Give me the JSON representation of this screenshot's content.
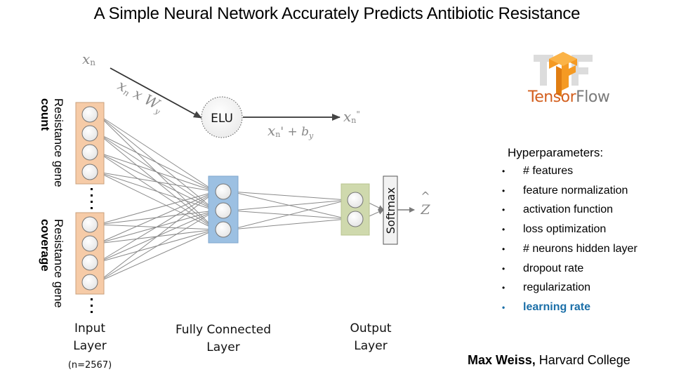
{
  "title": "A Simple Neural Network Accurately Predicts Antibiotic Resistance",
  "diagram": {
    "input_label_top": "x",
    "input_label_top_sub": "n",
    "weight_label": "x",
    "weight_label_sub": "n",
    "weight_label_rest": " x W",
    "weight_label_rest_sub": "y",
    "activation": "ELU",
    "bias_label": "x",
    "bias_label_sub": "n",
    "bias_label_rest": "' + b",
    "bias_label_rest_sub": "y",
    "output_label": "x",
    "output_label_sub": "n",
    "output_label_prime": "\"",
    "softmax": "Softmax",
    "prediction": "Z",
    "prediction_hat": "^",
    "group_1_label_line1": "Resistance gene",
    "group_1_label_line2": "count",
    "group_2_label_line1": "Resistance gene",
    "group_2_label_line2": "coverage",
    "layers": {
      "input": {
        "line1": "Input",
        "line2": "Layer",
        "note": "(n=2567)"
      },
      "hidden": {
        "line1": "Fully Connected",
        "line2": "Layer"
      },
      "output": {
        "line1": "Output",
        "line2": "Layer"
      }
    },
    "colors": {
      "input_layer": "#f6cba7",
      "hidden_layer": "#9cc0e2",
      "output_layer": "#cfd9ad",
      "connection": "#8a8a8a"
    }
  },
  "logo": {
    "name": "TensorFlow",
    "part1": "Tensor",
    "part2": "Flow",
    "colors": {
      "primary": "#f59a23",
      "text1": "#d35f1e",
      "text2": "#7a7a7a"
    }
  },
  "hyperparameters": {
    "title": "Hyperparameters:",
    "items": [
      {
        "label": "# features",
        "highlight": false
      },
      {
        "label": "feature normalization",
        "highlight": false
      },
      {
        "label": "activation function",
        "highlight": false
      },
      {
        "label": "loss optimization",
        "highlight": false
      },
      {
        "label": "# neurons hidden layer",
        "highlight": false
      },
      {
        "label": "dropout rate",
        "highlight": false
      },
      {
        "label": "regularization",
        "highlight": false
      },
      {
        "label": "learning rate",
        "highlight": true
      }
    ],
    "highlight_color": "#1b6fa8"
  },
  "author": {
    "name": "Max Weiss,",
    "affiliation": " Harvard College"
  }
}
